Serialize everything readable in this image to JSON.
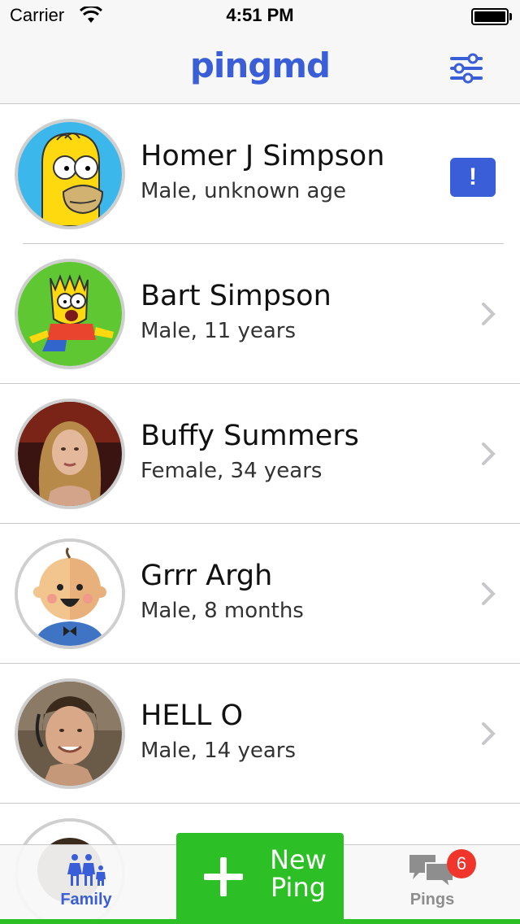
{
  "status_bar": {
    "carrier": "Carrier",
    "time": "4:51 PM"
  },
  "nav_bar": {
    "title": "pingmd",
    "settings_icon": "sliders-icon"
  },
  "family": [
    {
      "name": "Homer J Simpson",
      "detail": "Male, unknown age",
      "accessory": "alert",
      "alert_label": "!",
      "avatar": "homer-avatar"
    },
    {
      "name": "Bart Simpson",
      "detail": "Male, 11 years",
      "accessory": "chevron",
      "avatar": "bart-avatar"
    },
    {
      "name": "Buffy Summers",
      "detail": "Female, 34 years",
      "accessory": "chevron",
      "avatar": "buffy-photo"
    },
    {
      "name": "Grrr Argh",
      "detail": "Male, 8 months",
      "accessory": "chevron",
      "avatar": "baby-avatar"
    },
    {
      "name": "HELL O",
      "detail": "Male, 14 years",
      "accessory": "chevron",
      "avatar": "teen-photo"
    }
  ],
  "tab_bar": {
    "family_label": "Family",
    "pings_label": "Pings",
    "pings_badge": "6",
    "new_ping_line1": "New",
    "new_ping_line2": "Ping"
  },
  "colors": {
    "brand_blue": "#3a5ed8",
    "new_ping_green": "#2cc026",
    "badge_red": "#f0352c"
  }
}
